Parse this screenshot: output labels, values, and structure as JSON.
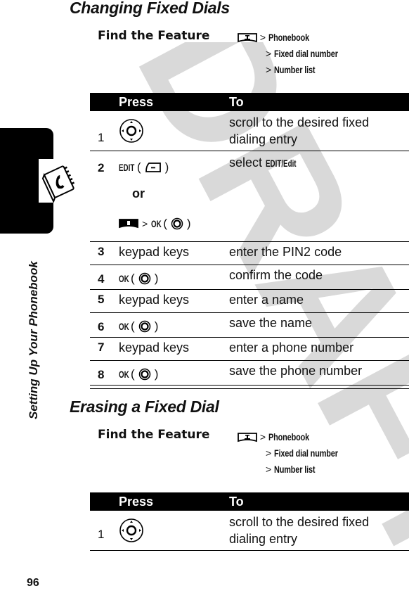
{
  "watermark": "DRAFT",
  "side": {
    "label": "Setting Up Your Phonebook",
    "page_number": "96"
  },
  "sections": [
    {
      "title": "Changing Fixed Dials",
      "find_label": "Find the Feature",
      "path": [
        "Phonebook",
        "Fixed dial number",
        "Number list"
      ],
      "headers": {
        "press": "Press",
        "to": "To"
      },
      "rows": [
        {
          "num": "1",
          "press_icon": "navigation-key-icon",
          "to": "scroll to the desired fixed dialing entry"
        },
        {
          "num": "2",
          "press_key": "EDIT",
          "press_icon": "left-soft-key-icon",
          "or": "or",
          "alt_key": "OK",
          "to_prefix": "select",
          "to_key": "EDIT/Edit"
        },
        {
          "num": "3",
          "press": "keypad keys",
          "to": "enter the PIN2 code"
        },
        {
          "num": "4",
          "press_key": "OK",
          "to": "confirm the code"
        },
        {
          "num": "5",
          "press": "keypad keys",
          "to": "enter a name"
        },
        {
          "num": "6",
          "press_key": "OK",
          "to": "save the name"
        },
        {
          "num": "7",
          "press": "keypad keys",
          "to": "enter a phone number"
        },
        {
          "num": "8",
          "press_key": "OK",
          "to": "save the phone number"
        }
      ]
    },
    {
      "title": "Erasing a Fixed Dial",
      "find_label": "Find the Feature",
      "path": [
        "Phonebook",
        "Fixed dial number",
        "Number list"
      ],
      "headers": {
        "press": "Press",
        "to": "To"
      },
      "rows": [
        {
          "num": "1",
          "press_icon": "navigation-key-icon",
          "to": "scroll to the desired fixed dialing entry"
        }
      ]
    }
  ],
  "symbols": {
    "gt": ">",
    "open": "(",
    "close": ")"
  }
}
